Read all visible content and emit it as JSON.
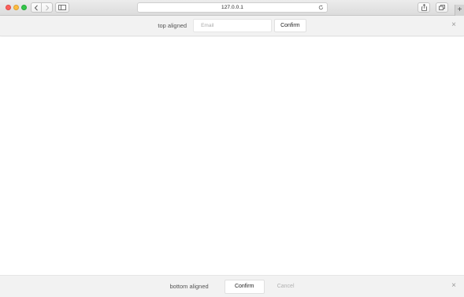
{
  "browser": {
    "address": "127.0.0.1",
    "new_tab_label": "+"
  },
  "top_bar": {
    "label": "top aligned",
    "email_placeholder": "Email",
    "email_value": "",
    "confirm_label": "Confirm",
    "close_glyph": "×"
  },
  "bottom_bar": {
    "label": "bottom aligned",
    "confirm_label": "Confirm",
    "cancel_label": "Cancel",
    "close_glyph": "×"
  },
  "icons": {
    "back": "chevron-left-icon",
    "forward": "chevron-right-icon",
    "sidebar": "sidebar-icon",
    "reload": "reload-icon",
    "share": "share-icon",
    "tabs": "tabs-overview-icon"
  },
  "colors": {
    "close_red": "#fc605c",
    "minimize_yellow": "#fdbc40",
    "zoom_green": "#34c84a",
    "bar_background": "#f2f2f2",
    "cancel_text": "#b0b0b0"
  }
}
